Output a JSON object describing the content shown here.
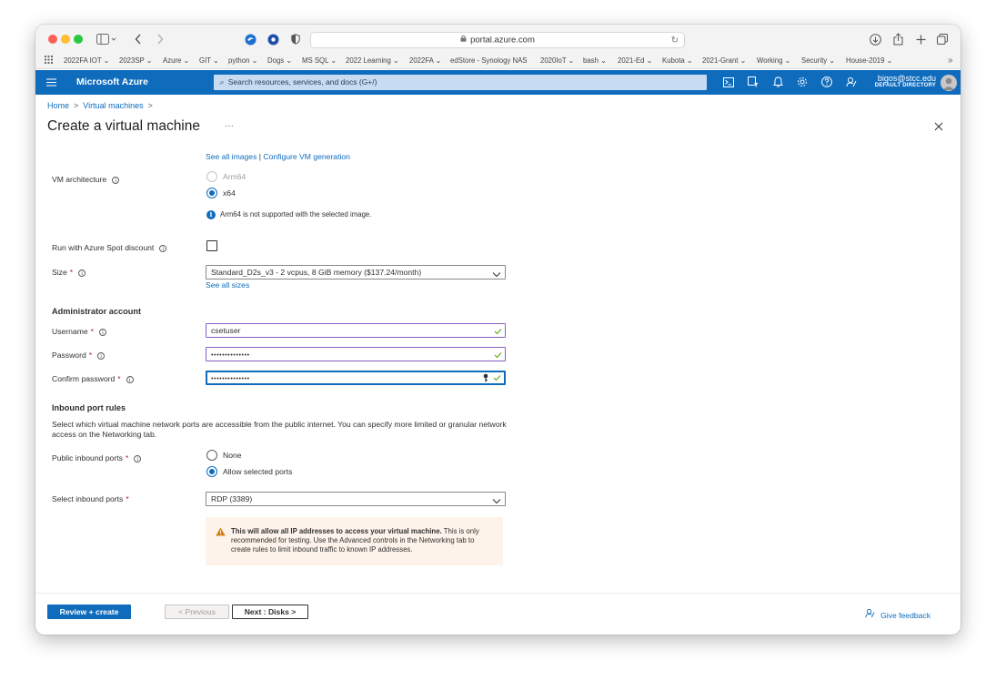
{
  "browser": {
    "url": "portal.azure.com",
    "bookmarks": [
      "2022FA IOT",
      "2023SP",
      "Azure",
      "GIT",
      "python",
      "Dogs",
      "MS SQL",
      "2022 Learning",
      "2022FA",
      "edStore - Synology NAS",
      "2020IoT",
      "bash",
      "2021-Ed",
      "Kubota",
      "2021-Grant",
      "Working",
      "Security",
      "House-2019"
    ],
    "bookmark_dropdown": [
      true,
      true,
      true,
      true,
      true,
      true,
      true,
      true,
      true,
      false,
      true,
      true,
      true,
      true,
      true,
      true,
      true,
      true
    ]
  },
  "azure": {
    "brand": "Microsoft Azure",
    "search_placeholder": "Search resources, services, and docs (G+/)",
    "user_email": "bigos@stcc.edu",
    "user_directory": "DEFAULT DIRECTORY"
  },
  "breadcrumb": {
    "home": "Home",
    "vms": "Virtual machines"
  },
  "page": {
    "title": "Create a virtual machine",
    "more": "···"
  },
  "form": {
    "see_all_images": "See all images",
    "link_separator": "|",
    "configure_vm_generation": "Configure VM generation",
    "vm_architecture_label": "VM architecture",
    "arch_options": [
      "Arm64",
      "x64"
    ],
    "arch_selected": "x64",
    "arch_info": "Arm64 is not supported with the selected image.",
    "spot_label": "Run with Azure Spot discount",
    "spot_checked": false,
    "size_label": "Size",
    "size_value": "Standard_D2s_v3 - 2 vcpus, 8 GiB memory ($137.24/month)",
    "see_all_sizes": "See all sizes",
    "admin_section": "Administrator account",
    "username_label": "Username",
    "username_value": "csetuser",
    "password_label": "Password",
    "password_value": "••••••••••••••",
    "confirm_password_label": "Confirm password",
    "confirm_password_value": "••••••••••••••",
    "inbound_section": "Inbound port rules",
    "inbound_desc": "Select which virtual machine network ports are accessible from the public internet. You can specify more limited or granular network access on the Networking tab.",
    "public_ports_label": "Public inbound ports",
    "port_options": [
      "None",
      "Allow selected ports"
    ],
    "port_selected": "Allow selected ports",
    "select_ports_label": "Select inbound ports",
    "select_ports_value": "RDP (3389)",
    "warning_bold": "This will allow all IP addresses to access your virtual machine.",
    "warning_text": "This is only recommended for testing.  Use the Advanced controls in the Networking tab to create rules to limit inbound traffic to known IP addresses."
  },
  "footer": {
    "review_create": "Review + create",
    "previous": "< Previous",
    "next": "Next : Disks >",
    "feedback": "Give feedback"
  },
  "colors": {
    "azure_blue": "#0f6cbd",
    "valid_purple": "#8661c5",
    "required_red": "#a4262c",
    "warning_bg": "#fdf3ea",
    "warning_icon": "#d67f0b"
  }
}
